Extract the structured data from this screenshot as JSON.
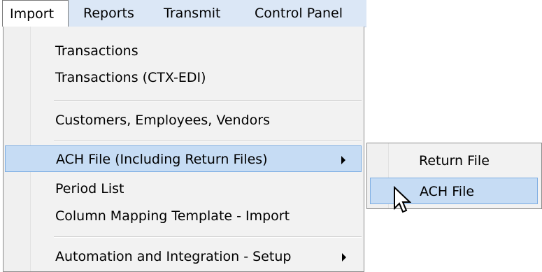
{
  "menubar": {
    "items": [
      {
        "label": "Import"
      },
      {
        "label": "Reports"
      },
      {
        "label": "Transmit"
      },
      {
        "label": "Control Panel"
      }
    ]
  },
  "import_menu": {
    "items": [
      {
        "label": "Transactions"
      },
      {
        "label": "Transactions (CTX-EDI)"
      },
      {
        "label": "Customers, Employees, Vendors"
      },
      {
        "label": "ACH File (Including Return Files)"
      },
      {
        "label": "Period List"
      },
      {
        "label": "Column Mapping Template - Import"
      },
      {
        "label": "Automation and Integration - Setup"
      }
    ]
  },
  "ach_submenu": {
    "items": [
      {
        "label": "Return File"
      },
      {
        "label": "ACH File"
      }
    ]
  },
  "colors": {
    "menubar_bg": "#dbe7f6",
    "menu_bg": "#f2f2f2",
    "highlight_bg": "#c6dcf4",
    "highlight_border": "#7eaee3"
  }
}
